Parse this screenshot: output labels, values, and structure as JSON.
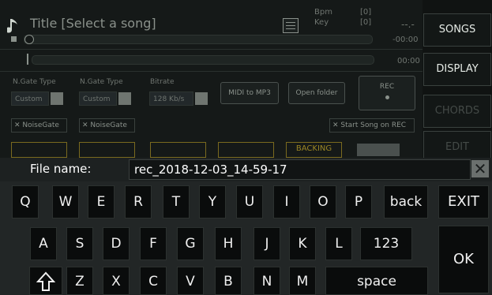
{
  "player": {
    "title": "Title [Select a song]",
    "bpm_label": "Bpm",
    "key_label": "Key",
    "bpm_value": "[0]",
    "key_value": "[0]",
    "time_main": "--.-",
    "time_total": "-00:00",
    "time_secondary": "00:00"
  },
  "controls": {
    "ngate1_label": "N.Gate Type",
    "ngate1_value": "Custom",
    "ngate2_label": "N.Gate Type",
    "ngate2_value": "Custom",
    "bitrate_label": "Bitrate",
    "bitrate_value": "128 Kb/s",
    "midi_to_mp3": "MIDI to MP3",
    "open_folder": "Open folder",
    "rec": "REC",
    "noisegate1": "✕ NoiseGate",
    "noisegate2": "✕ NoiseGate",
    "start_on_rec": "✕ Start Song on REC",
    "backing": "BACKING"
  },
  "sidebar": {
    "songs": "SONGS",
    "display": "DISPLAY",
    "chords": "CHORDS",
    "edit": "EDIT"
  },
  "dialog": {
    "label": "File name:",
    "value": "rec_2018-12-03_14-59-17"
  },
  "keyboard": {
    "row1": [
      "Q",
      "W",
      "E",
      "R",
      "T",
      "Y",
      "U",
      "I",
      "O",
      "P",
      "back"
    ],
    "row2": [
      "A",
      "S",
      "D",
      "F",
      "G",
      "H",
      "J",
      "K",
      "L",
      "123"
    ],
    "row3": [
      "Z",
      "X",
      "C",
      "V",
      "B",
      "N",
      "M",
      "space"
    ],
    "exit": "EXIT",
    "ok": "OK"
  }
}
